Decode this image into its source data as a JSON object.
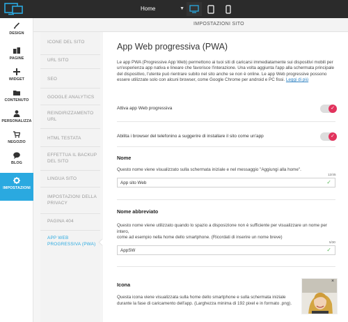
{
  "topbar": {
    "logo_icon": "monitor-logo-icon",
    "page_select": "Home",
    "devices": [
      "desktop-icon",
      "tablet-icon",
      "phone-icon"
    ]
  },
  "sidebar": {
    "items": [
      {
        "label": "DESIGN",
        "icon": "brush-icon"
      },
      {
        "label": "PAGINE",
        "icon": "pages-icon"
      },
      {
        "label": "WIDGET",
        "icon": "plus-icon"
      },
      {
        "label": "CONTENUTO",
        "icon": "folder-icon"
      },
      {
        "label": "PERSONALIZZA",
        "icon": "user-icon"
      },
      {
        "label": "NEGOZIO",
        "icon": "cart-icon"
      },
      {
        "label": "BLOG",
        "icon": "chat-icon"
      },
      {
        "label": "IMPOSTAZIONI",
        "icon": "gear-icon"
      }
    ],
    "active_index": 7
  },
  "header": {
    "title": "IMPOSTAZIONI SITO"
  },
  "settings_nav": [
    "ICONE DEL SITO",
    "URL SITO",
    "SEO",
    "GOOGLE ANALYTICS",
    "REINDIRIZZAMENTO URL",
    "HTML TESTATA",
    "EFFETTUA IL BACKUP DEL SITO",
    "LINGUA SITO",
    "IMPOSTAZIONI DELLA PRIVACY",
    "PAGINA 404",
    "APP WEB PROGRESSIVA (PWA)"
  ],
  "main": {
    "title": "App Web progressiva (PWA)",
    "intro": "Le app PWA (Progressive App Web) permettono ai tuoi siti di caricarsi immediatamente sui dispositivi mobili per un'esperienza app nativa e lineare che favorisce l'interazione. Una volta aggiunta l'app alla schermata principale del dispositivo, l'utente può rientrare subito nel sito anche se non è online. Le app Web progressive possono essere utilizzate solo con alcuni browser, come Google Chrome per android e PC fissi.",
    "learn_more": "Leggi di più",
    "toggle1_label": "Attiva app Web progressiva",
    "toggle2_label": "Abilita i browser del telefonino a suggerire di installare il sito come un'app",
    "name": {
      "title": "Nome",
      "desc": "Questo nome viene visualizzato sulla schermata iniziale e nel messaggio \"Aggiungi alla home\".",
      "counter": "12/45",
      "value": "App sito Web"
    },
    "short_name": {
      "title": "Nome abbreviato",
      "desc1": "Questo nome viene utilizzato quando lo spazio a disposizione non è sufficiente per visualizzare un nome per intero,",
      "desc2": "come ad esempio nella home dello smartphone. (Ricordati di inserire un nome breve)",
      "counter": "5/30",
      "value": "AppSW"
    },
    "icon": {
      "title": "Icona",
      "desc": "Questa icona viene visualizzata sulla home dello smartphone e sulla schermata iniziale durante la fase di caricamento dell'app. (Larghezza minima di 192 pixel e in formato .png).",
      "close": "×"
    },
    "toggle_check": "✓",
    "field_check": "✓"
  },
  "colors": {
    "accent": "#2aa9e0",
    "toggle": "#e2335d",
    "topbar": "#2b2b2b"
  }
}
